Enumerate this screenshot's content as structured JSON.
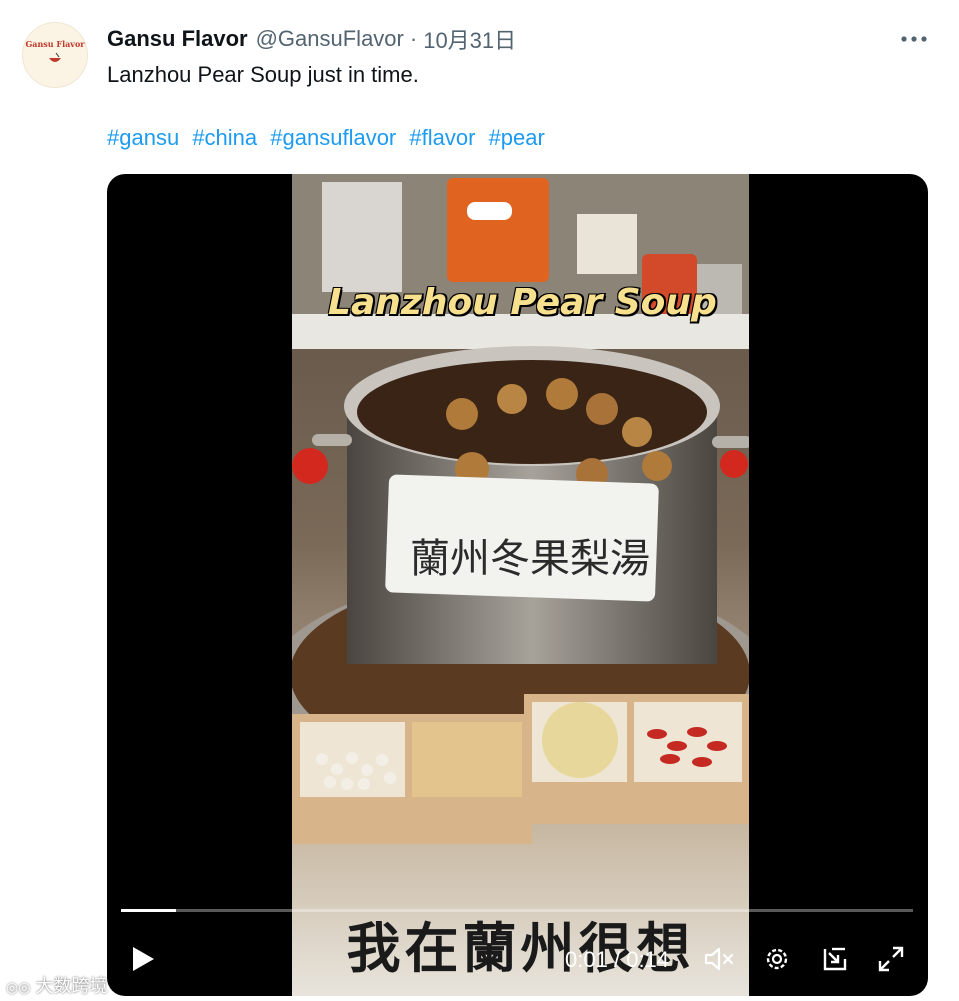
{
  "tweet": {
    "author_name": "Gansu Flavor",
    "handle": "@GansuFlavor",
    "separator": "·",
    "date": "10月31日",
    "text": "Lanzhou Pear Soup just in time.",
    "hashtags": [
      "#gansu",
      "#china",
      "#gansuflavor",
      "#flavor",
      "#pear"
    ]
  },
  "avatar": {
    "logo_text": "Gansu Flavor"
  },
  "video": {
    "overlay_title": "Lanzhou Pear Soup",
    "sign_text": "蘭州冬果梨湯",
    "subtitle": "我在蘭州很想",
    "current_time": "0:01",
    "time_sep": "/",
    "duration": "0:14",
    "progress_fraction": 0.07
  },
  "watermark": {
    "text": "大数跨境"
  },
  "icons": {
    "more": "more-options-icon",
    "play": "play-icon",
    "mute": "muted-speaker-icon",
    "settings": "settings-gear-icon",
    "pip": "picture-in-picture-icon",
    "fullscreen": "fullscreen-icon"
  },
  "colors": {
    "link": "#1d9bf0",
    "secondary_text": "#536471",
    "primary_text": "#0f1419"
  }
}
